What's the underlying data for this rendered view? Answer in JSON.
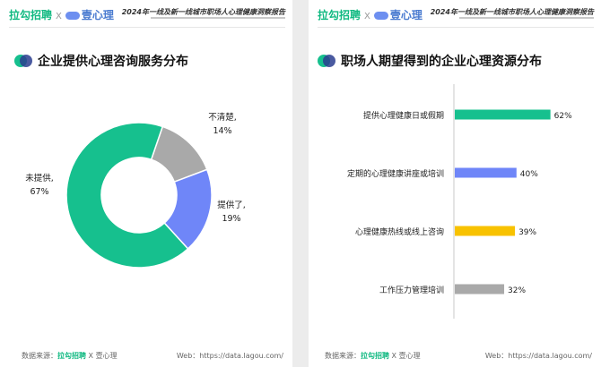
{
  "header": {
    "brand_name": "拉勾招聘",
    "separator": "X",
    "partner_name": "壹心理",
    "report_title": "2024年一线及新一线城市职场人心理健康洞察报告"
  },
  "footer": {
    "source_label": "数据来源：",
    "source_brand": "拉勾招聘",
    "source_sep": "X",
    "source_partner": "壹心理",
    "website": "Web：https://data.lagou.com/"
  },
  "colors": {
    "green": "#16c08e",
    "blue": "#6f86f8",
    "gray": "#a9a9a9",
    "yellow": "#f8c200"
  },
  "chart_data": [
    {
      "type": "pie",
      "title": "企业提供心理咨询服务分布",
      "donut": true,
      "slices": [
        {
          "label": "未提供,",
          "value_label": "67%",
          "value": 67,
          "color": "#16c08e"
        },
        {
          "label": "不清楚,",
          "value_label": "14%",
          "value": 14,
          "color": "#a9a9a9"
        },
        {
          "label": "提供了,",
          "value_label": "19%",
          "value": 19,
          "color": "#6f86f8"
        }
      ]
    },
    {
      "type": "bar",
      "orientation": "horizontal",
      "title": "职场人期望得到的企业心理资源分布",
      "categories": [
        "提供心理健康日或假期",
        "定期的心理健康讲座或培训",
        "心理健康热线或线上咨询",
        "工作压力管理培训"
      ],
      "values": [
        62,
        40,
        39,
        32
      ],
      "value_labels": [
        "62%",
        "40%",
        "39%",
        "32%"
      ],
      "colors": [
        "#16c08e",
        "#6f86f8",
        "#f8c200",
        "#a9a9a9"
      ],
      "xlim": [
        0,
        100
      ]
    }
  ]
}
